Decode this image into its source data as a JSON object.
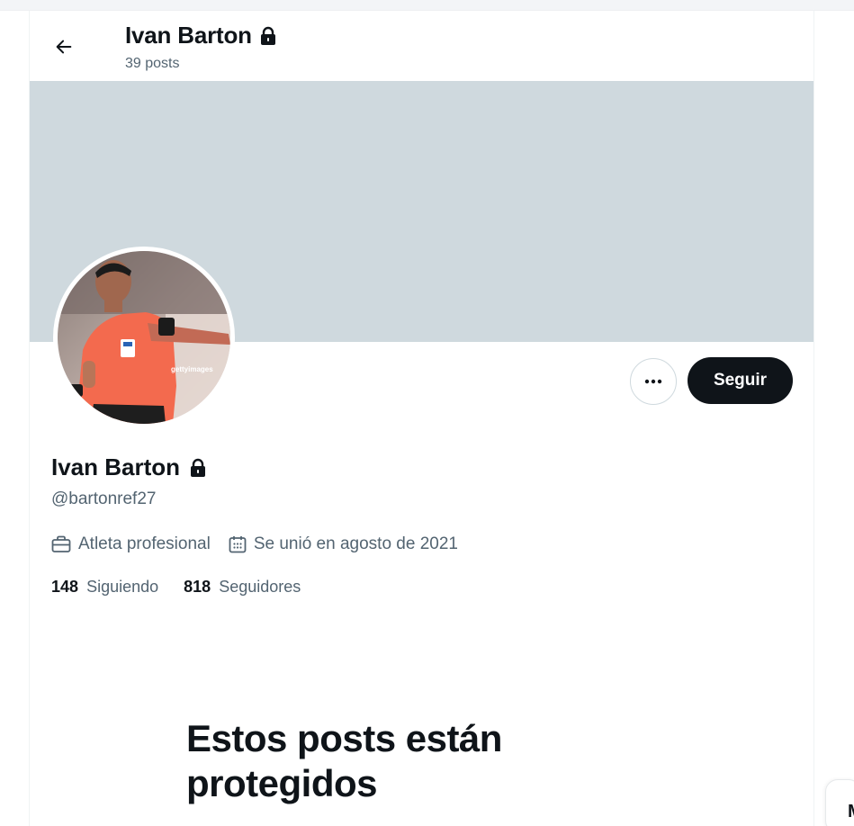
{
  "header": {
    "name": "Ivan Barton",
    "posts_count": "39 posts"
  },
  "profile": {
    "name": "Ivan Barton",
    "handle": "@bartonref27",
    "category": "Atleta profesional",
    "joined": "Se unió en agosto de 2021",
    "following_count": "148",
    "following_label": "Siguiendo",
    "followers_count": "818",
    "followers_label": "Seguidores"
  },
  "actions": {
    "more_label": "•••",
    "follow_label": "Seguir"
  },
  "avatar": {
    "watermark": "gettyimages"
  },
  "protected": {
    "title": "Estos posts están protegidos"
  },
  "sidebar_peek": {
    "letter": "M"
  },
  "colors": {
    "banner": "#cfd9de",
    "primary_text": "#0f1419",
    "secondary_text": "#536471",
    "follow_button": "#0f1419"
  },
  "icons": [
    "back-arrow-icon",
    "lock-icon",
    "more-icon",
    "briefcase-icon",
    "calendar-icon"
  ]
}
